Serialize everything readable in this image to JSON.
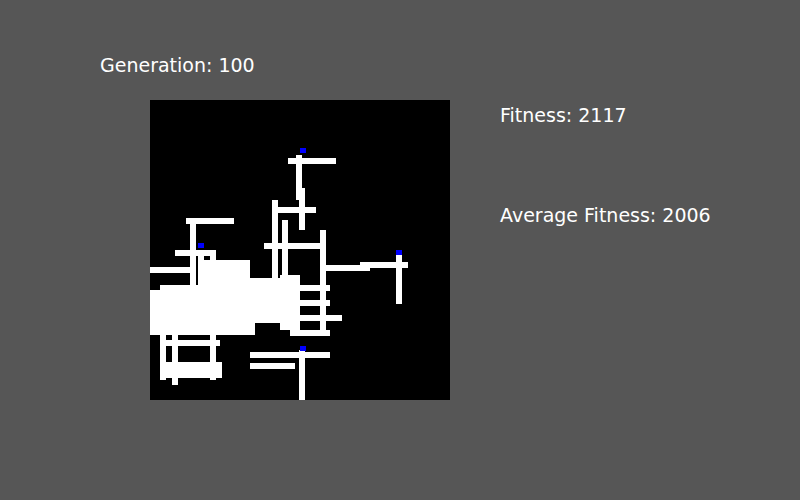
{
  "header": {
    "generation": "Generation: 100"
  },
  "stats": [
    {
      "label": "Fitness: 2117"
    },
    {
      "label": "Average Fitness: 2006"
    }
  ]
}
